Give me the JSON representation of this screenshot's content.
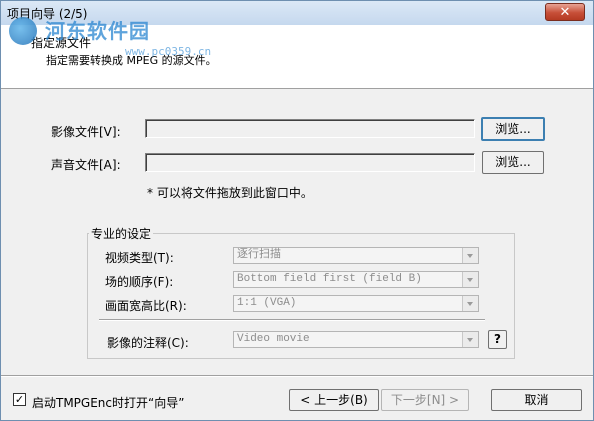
{
  "window": {
    "title": "项目向导 (2/5)",
    "close_glyph": "✕"
  },
  "watermark": {
    "text": "河东软件园",
    "url": "www.pc0359.cn"
  },
  "header": {
    "title": "指定源文件",
    "subtitle": "指定需要转换成 MPEG 的源文件。"
  },
  "video_file": {
    "label": "影像文件[V]:",
    "value": "",
    "browse_label": "浏览..."
  },
  "audio_file": {
    "label": "声音文件[A]:",
    "value": "",
    "browse_label": "浏览..."
  },
  "drag_hint": "* 可以将文件拖放到此窗口中。",
  "advanced": {
    "legend": "专业的设定",
    "video_type": {
      "label": "视频类型(T):",
      "value": "逐行扫描"
    },
    "field_order": {
      "label": "场的顺序(F):",
      "value": "Bottom field first (field B)"
    },
    "aspect_ratio": {
      "label": "画面宽高比(R):",
      "value": "1:1 (VGA)"
    },
    "video_comment": {
      "label": "影像的注释(C):",
      "value": "Video movie",
      "help_label": "?"
    }
  },
  "footer": {
    "startup_checkbox": {
      "label": "启动TMPGEnc时打开“向导”",
      "checked": true,
      "check_glyph": "✓"
    },
    "back_button": "< 上一步(B)",
    "next_button": "下一步[N] >",
    "cancel_button": "取消"
  }
}
